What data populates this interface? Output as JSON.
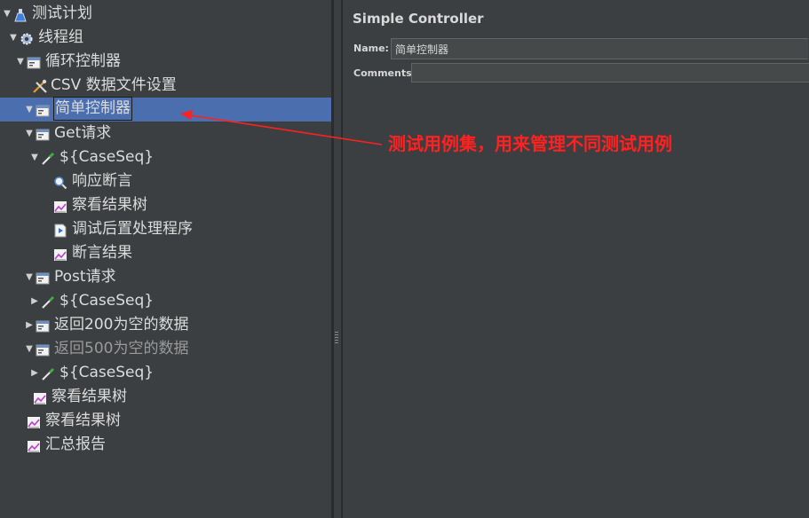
{
  "tree": [
    {
      "label": "测试计划",
      "icon": "flask-icon",
      "indent": 0,
      "expanded": true
    },
    {
      "label": "线程组",
      "icon": "gear-icon",
      "indent": 1,
      "expanded": true
    },
    {
      "label": "循环控制器",
      "icon": "controller-icon",
      "indent": 2,
      "expanded": true
    },
    {
      "label": "CSV 数据文件设置",
      "icon": "tools-icon",
      "indent": 3,
      "expanded": null
    },
    {
      "label": "简单控制器",
      "icon": "controller-icon",
      "indent": 3,
      "expanded": true,
      "selected": true
    },
    {
      "label": "Get请求",
      "icon": "controller-icon",
      "indent": 4,
      "expanded": true
    },
    {
      "label": "${CaseSeq}",
      "icon": "pipette-icon",
      "indent": 5,
      "expanded": true
    },
    {
      "label": "响应断言",
      "icon": "magnifier-icon",
      "indent": 6,
      "expanded": null
    },
    {
      "label": "察看结果树",
      "icon": "graph-icon",
      "indent": 6,
      "expanded": null
    },
    {
      "label": "调试后置处理程序",
      "icon": "document-icon",
      "indent": 6,
      "expanded": null
    },
    {
      "label": "断言结果",
      "icon": "graph-icon",
      "indent": 6,
      "expanded": null
    },
    {
      "label": "Post请求",
      "icon": "controller-icon",
      "indent": 4,
      "expanded": true
    },
    {
      "label": "${CaseSeq}",
      "icon": "pipette-icon",
      "indent": 5,
      "expanded": false
    },
    {
      "label": "返回200为空的数据",
      "icon": "controller-icon",
      "indent": 4,
      "expanded": false
    },
    {
      "label": "返回500为空的数据",
      "icon": "controller-icon",
      "indent": 4,
      "expanded": true,
      "disabled": true
    },
    {
      "label": "${CaseSeq}",
      "icon": "pipette-icon",
      "indent": 5,
      "expanded": false
    },
    {
      "label": "察看结果树",
      "icon": "graph-icon",
      "indent": 4,
      "expanded": null
    },
    {
      "label": "察看结果树",
      "icon": "graph-icon",
      "indent": 3,
      "expanded": null
    },
    {
      "label": "汇总报告",
      "icon": "graph-icon",
      "indent": 3,
      "expanded": null
    }
  ],
  "panel": {
    "title": "Simple Controller",
    "name_label": "Name:",
    "name_value": "简单控制器",
    "comments_label": "Comments:"
  },
  "annotation": {
    "text": "测试用例集，用来管理不同测试用例",
    "color": "#ff2020"
  }
}
